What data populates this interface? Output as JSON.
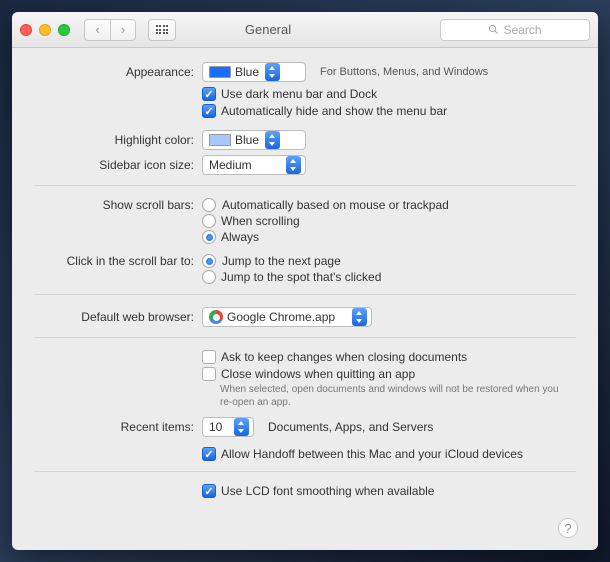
{
  "window": {
    "title": "General"
  },
  "search": {
    "placeholder": "Search"
  },
  "appearance": {
    "label": "Appearance:",
    "value": "Blue",
    "hint": "For Buttons, Menus, and Windows",
    "dark_menu": "Use dark menu bar and Dock",
    "auto_hide": "Automatically hide and show the menu bar"
  },
  "highlight": {
    "label": "Highlight color:",
    "value": "Blue"
  },
  "sidebar": {
    "label": "Sidebar icon size:",
    "value": "Medium"
  },
  "scrollbars": {
    "label": "Show scroll bars:",
    "opt1": "Automatically based on mouse or trackpad",
    "opt2": "When scrolling",
    "opt3": "Always"
  },
  "click_scroll": {
    "label": "Click in the scroll bar to:",
    "opt1": "Jump to the next page",
    "opt2": "Jump to the spot that's clicked"
  },
  "browser": {
    "label": "Default web browser:",
    "value": "Google Chrome.app"
  },
  "docs": {
    "ask": "Ask to keep changes when closing documents",
    "close": "Close windows when quitting an app",
    "hint": "When selected, open documents and windows will not be restored when you re-open an app."
  },
  "recent": {
    "label": "Recent items:",
    "value": "10",
    "after": "Documents, Apps, and Servers"
  },
  "handoff": {
    "label": "Allow Handoff between this Mac and your iCloud devices"
  },
  "lcd": {
    "label": "Use LCD font smoothing when available"
  },
  "help": "?"
}
